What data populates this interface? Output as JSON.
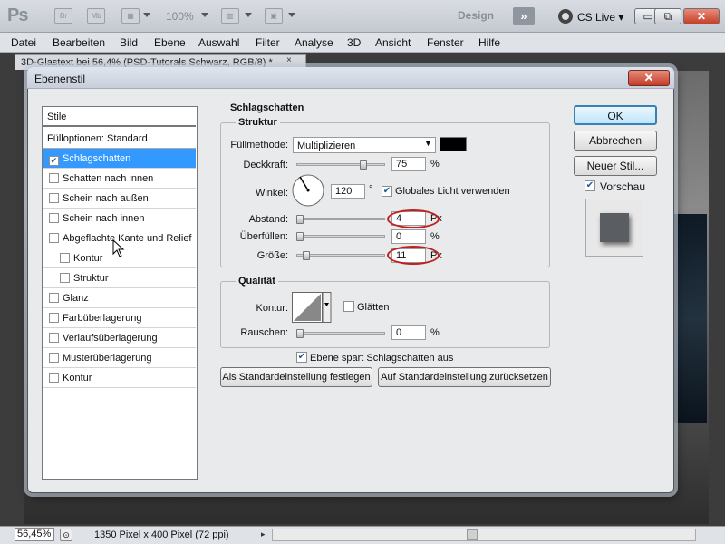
{
  "app": {
    "logo": "Ps",
    "toolbar_icons": [
      "Br",
      "Mb"
    ],
    "zoom": "100%",
    "workspace": "Design",
    "expand": "»",
    "cs_live": "CS Live",
    "window_buttons": [
      "▭",
      "⧉",
      "✕"
    ]
  },
  "menu": [
    "Datei",
    "Bearbeiten",
    "Bild",
    "Ebene",
    "Auswahl",
    "Filter",
    "Analyse",
    "3D",
    "Ansicht",
    "Fenster",
    "Hilfe"
  ],
  "document": {
    "tab_title": "3D-Glastext bei 56,4% (PSD-Tutorals Schwarz, RGB/8) *",
    "tab_close": "×"
  },
  "status": {
    "zoom": "56,45%",
    "info": "1350 Pixel x 400 Pixel (72 ppi)"
  },
  "dialog": {
    "title": "Ebenenstil",
    "close": "✕",
    "list_header": "Stile",
    "blend_options": "Fülloptionen: Standard",
    "styles": [
      {
        "label": "Schlagschatten",
        "checked": true,
        "selected": true
      },
      {
        "label": "Schatten nach innen",
        "checked": false
      },
      {
        "label": "Schein nach außen",
        "checked": false
      },
      {
        "label": "Schein nach innen",
        "checked": false
      },
      {
        "label": "Abgeflachte Kante und Relief",
        "checked": false
      },
      {
        "label": "Kontur",
        "checked": false,
        "indent": true
      },
      {
        "label": "Struktur",
        "checked": false,
        "indent": true
      },
      {
        "label": "Glanz",
        "checked": false
      },
      {
        "label": "Farbüberlagerung",
        "checked": false
      },
      {
        "label": "Verlaufsüberlagerung",
        "checked": false
      },
      {
        "label": "Musterüberlagerung",
        "checked": false
      },
      {
        "label": "Kontur",
        "checked": false
      }
    ],
    "section_title": "Schlagschatten",
    "struktur": {
      "title": "Struktur",
      "blend_mode_label": "Füllmethode:",
      "blend_mode_value": "Multiplizieren",
      "shadow_color": "#000000",
      "opacity_label": "Deckkraft:",
      "opacity_value": "75",
      "opacity_unit": "%",
      "angle_label": "Winkel:",
      "angle_value": "120",
      "angle_unit": "°",
      "global_light_label": "Globales Licht verwenden",
      "global_light_checked": true,
      "distance_label": "Abstand:",
      "distance_value": "4",
      "distance_unit": "Px",
      "spread_label": "Überfüllen:",
      "spread_value": "0",
      "spread_unit": "%",
      "size_label": "Größe:",
      "size_value": "11",
      "size_unit": "Px"
    },
    "quality": {
      "title": "Qualität",
      "contour_label": "Kontur:",
      "antialias_label": "Glätten",
      "noise_label": "Rauschen:",
      "noise_value": "0",
      "noise_unit": "%"
    },
    "knockout_label": "Ebene spart Schlagschatten aus",
    "make_default": "Als Standardeinstellung festlegen",
    "reset_default": "Auf Standardeinstellung zurücksetzen",
    "ok": "OK",
    "cancel": "Abbrechen",
    "new_style": "Neuer Stil...",
    "preview_label": "Vorschau",
    "accent": "#3399ff",
    "annotation_color": "#c02020"
  }
}
